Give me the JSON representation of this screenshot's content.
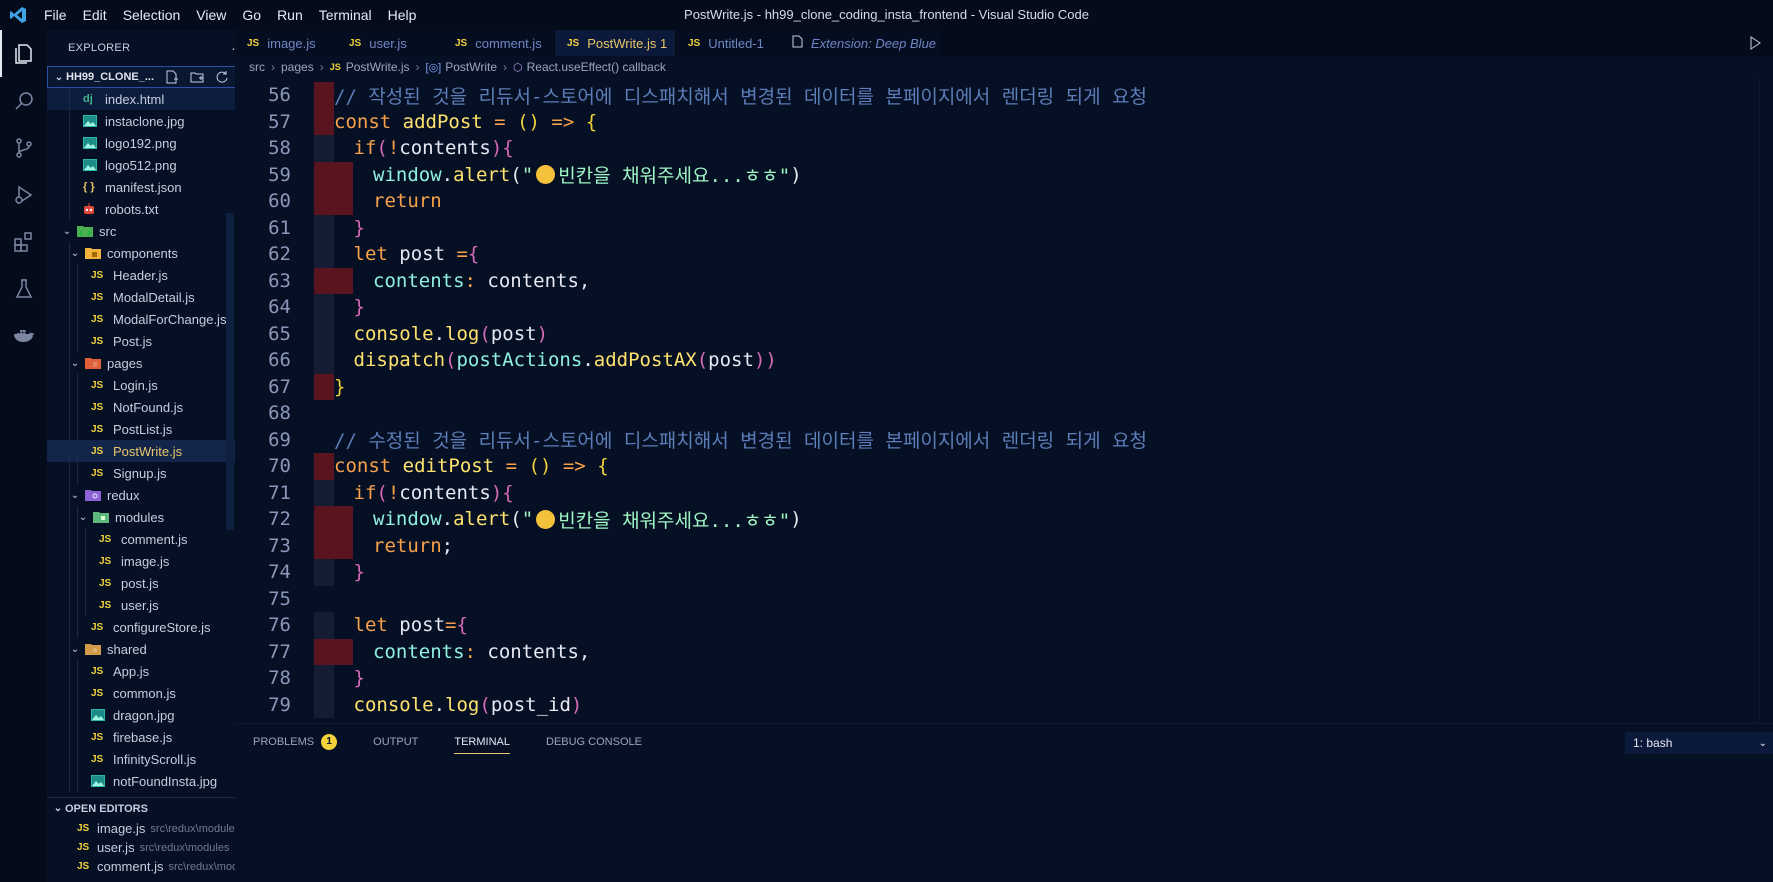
{
  "window": {
    "title": "PostWrite.js - hh99_clone_coding_insta_frontend - Visual Studio Code"
  },
  "menu": [
    "File",
    "Edit",
    "Selection",
    "View",
    "Go",
    "Run",
    "Terminal",
    "Help"
  ],
  "activity_bar": [
    "explorer-icon",
    "search-icon",
    "source-control-icon",
    "run-debug-icon",
    "extensions-icon",
    "testing-icon",
    "docker-icon"
  ],
  "explorer": {
    "title": "EXPLORER",
    "more": "···",
    "folder": "HH99_CLONE_...",
    "tree": [
      {
        "label": "index.html",
        "icon": "dj",
        "depth": 2,
        "state": "focused"
      },
      {
        "label": "instaclone.jpg",
        "icon": "image",
        "depth": 2
      },
      {
        "label": "logo192.png",
        "icon": "image",
        "depth": 2
      },
      {
        "label": "logo512.png",
        "icon": "image",
        "depth": 2
      },
      {
        "label": "manifest.json",
        "icon": "json",
        "depth": 2
      },
      {
        "label": "robots.txt",
        "icon": "robot",
        "depth": 2
      },
      {
        "label": "src",
        "icon": "folder-src",
        "depth": 1,
        "folder": true,
        "dot": true
      },
      {
        "label": "components",
        "icon": "folder-components",
        "depth": 2,
        "folder": true
      },
      {
        "label": "Header.js",
        "icon": "js",
        "depth": 3
      },
      {
        "label": "ModalDetail.js",
        "icon": "js",
        "depth": 3
      },
      {
        "label": "ModalForChange.js",
        "icon": "js",
        "depth": 3
      },
      {
        "label": "Post.js",
        "icon": "js",
        "depth": 3
      },
      {
        "label": "pages",
        "icon": "folder-pages",
        "depth": 2,
        "folder": true,
        "dot": true
      },
      {
        "label": "Login.js",
        "icon": "js",
        "depth": 3
      },
      {
        "label": "NotFound.js",
        "icon": "js",
        "depth": 3
      },
      {
        "label": "PostList.js",
        "icon": "js",
        "depth": 3
      },
      {
        "label": "PostWrite.js",
        "icon": "js",
        "depth": 3,
        "state": "selected",
        "badge": "1",
        "modified": true
      },
      {
        "label": "Signup.js",
        "icon": "js",
        "depth": 3
      },
      {
        "label": "redux",
        "icon": "folder-redux",
        "depth": 2,
        "folder": true
      },
      {
        "label": "modules",
        "icon": "folder-modules",
        "depth": 3,
        "folder": true
      },
      {
        "label": "comment.js",
        "icon": "js",
        "depth": 4
      },
      {
        "label": "image.js",
        "icon": "js",
        "depth": 4
      },
      {
        "label": "post.js",
        "icon": "js",
        "depth": 4
      },
      {
        "label": "user.js",
        "icon": "js",
        "depth": 4
      },
      {
        "label": "configureStore.js",
        "icon": "js",
        "depth": 3
      },
      {
        "label": "shared",
        "icon": "folder-shared",
        "depth": 2,
        "folder": true
      },
      {
        "label": "App.js",
        "icon": "js",
        "depth": 3
      },
      {
        "label": "common.js",
        "icon": "js",
        "depth": 3
      },
      {
        "label": "dragon.jpg",
        "icon": "image",
        "depth": 3
      },
      {
        "label": "firebase.js",
        "icon": "js",
        "depth": 3
      },
      {
        "label": "InfinityScroll.js",
        "icon": "js",
        "depth": 3
      },
      {
        "label": "notFoundInsta.jpg",
        "icon": "image",
        "depth": 3
      }
    ],
    "open_editors_title": "OPEN EDITORS",
    "open_editors": [
      {
        "name": "image.js",
        "path": "src\\redux\\modules"
      },
      {
        "name": "user.js",
        "path": "src\\redux\\modules"
      },
      {
        "name": "comment.js",
        "path": "src\\redux\\mod..."
      }
    ]
  },
  "tabs": [
    {
      "label": "image.js",
      "icon": "JS"
    },
    {
      "label": "user.js",
      "icon": "JS"
    },
    {
      "label": "comment.js",
      "icon": "JS"
    },
    {
      "label": "PostWrite.js 1",
      "icon": "JS",
      "active": true,
      "close": "×"
    },
    {
      "label": "Untitled-1",
      "icon": "JS"
    },
    {
      "label": "Extension: Deep Blue",
      "icon": "file",
      "preview": true
    }
  ],
  "breadcrumb": [
    "src",
    "pages",
    "PostWrite.js",
    "PostWrite",
    "React.useEffect() callback"
  ],
  "code": {
    "lines": [
      {
        "n": "56",
        "indent": 0,
        "err": [
          0
        ],
        "tokens": [
          [
            "cm",
            "// 작성된 것을 리듀서-스토어에 디스패치해서 변경된 데이터를 본페이지에서 렌더링 되게 요청"
          ]
        ]
      },
      {
        "n": "57",
        "indent": 0,
        "err": [
          0
        ],
        "tokens": [
          [
            "kw",
            "const "
          ],
          [
            "fn",
            "addPost"
          ],
          [
            "var",
            " "
          ],
          [
            "kw",
            "="
          ],
          [
            "var",
            " "
          ],
          [
            "p1",
            "()"
          ],
          [
            "var",
            " "
          ],
          [
            "kw",
            "=>"
          ],
          [
            "var",
            " "
          ],
          [
            "p1",
            "{"
          ]
        ]
      },
      {
        "n": "58",
        "indent": 1,
        "err": [],
        "tokens": [
          [
            "kw",
            "if"
          ],
          [
            "p2",
            "("
          ],
          [
            "kw",
            "!"
          ],
          [
            "var",
            "contents"
          ],
          [
            "p2",
            ")"
          ],
          [
            "p2",
            "{"
          ]
        ]
      },
      {
        "n": "59",
        "indent": 2,
        "err": [
          0,
          1
        ],
        "tokens": [
          [
            "obj",
            "window"
          ],
          [
            "var",
            "."
          ],
          [
            "fn",
            "alert"
          ],
          [
            "var",
            "("
          ],
          [
            "str",
            "\""
          ],
          [
            "emoji",
            ""
          ],
          [
            "str",
            "빈칸을 채워주세요...ㅎㅎ\""
          ],
          [
            "var",
            ")"
          ]
        ]
      },
      {
        "n": "60",
        "indent": 2,
        "err": [
          0,
          1
        ],
        "tokens": [
          [
            "kw",
            "return"
          ]
        ]
      },
      {
        "n": "61",
        "indent": 1,
        "err": [],
        "tokens": [
          [
            "p2",
            "}"
          ]
        ]
      },
      {
        "n": "62",
        "indent": 1,
        "err": [],
        "tokens": [
          [
            "kw",
            "let "
          ],
          [
            "var",
            "post "
          ],
          [
            "kw",
            "="
          ],
          [
            "p2",
            "{"
          ]
        ]
      },
      {
        "n": "63",
        "indent": 2,
        "err": [
          0,
          1
        ],
        "tokens": [
          [
            "prop",
            "contents"
          ],
          [
            "kw",
            ":"
          ],
          [
            "var",
            " contents,"
          ]
        ]
      },
      {
        "n": "64",
        "indent": 1,
        "err": [],
        "tokens": [
          [
            "p2",
            "}"
          ]
        ]
      },
      {
        "n": "65",
        "indent": 1,
        "err": [],
        "tokens": [
          [
            "fn",
            "console"
          ],
          [
            "var",
            "."
          ],
          [
            "fn",
            "log"
          ],
          [
            "p2",
            "("
          ],
          [
            "var",
            "post"
          ],
          [
            "p2",
            ")"
          ]
        ]
      },
      {
        "n": "66",
        "indent": 1,
        "err": [],
        "tokens": [
          [
            "fn",
            "dispatch"
          ],
          [
            "p2",
            "("
          ],
          [
            "obj",
            "postActions"
          ],
          [
            "var",
            "."
          ],
          [
            "fn",
            "addPostAX"
          ],
          [
            "p2",
            "("
          ],
          [
            "var",
            "post"
          ],
          [
            "p2",
            "))"
          ]
        ]
      },
      {
        "n": "67",
        "indent": 0,
        "err": [
          0
        ],
        "tokens": [
          [
            "p1",
            "}"
          ]
        ]
      },
      {
        "n": "68",
        "indent": 0,
        "err": [],
        "tokens": []
      },
      {
        "n": "69",
        "indent": 0,
        "err": [],
        "tokens": [
          [
            "cm",
            "// 수정된 것을 리듀서-스토어에 디스패치해서 변경된 데이터를 본페이지에서 렌더링 되게 요청"
          ]
        ]
      },
      {
        "n": "70",
        "indent": 0,
        "err": [
          0
        ],
        "tokens": [
          [
            "kw",
            "const "
          ],
          [
            "fn",
            "editPost"
          ],
          [
            "var",
            " "
          ],
          [
            "kw",
            "="
          ],
          [
            "var",
            " "
          ],
          [
            "p1",
            "()"
          ],
          [
            "var",
            " "
          ],
          [
            "kw",
            "=>"
          ],
          [
            "var",
            " "
          ],
          [
            "p1",
            "{"
          ]
        ]
      },
      {
        "n": "71",
        "indent": 1,
        "err": [],
        "tokens": [
          [
            "kw",
            "if"
          ],
          [
            "p2",
            "("
          ],
          [
            "kw",
            "!"
          ],
          [
            "var",
            "contents"
          ],
          [
            "p2",
            ")"
          ],
          [
            "p2",
            "{"
          ]
        ]
      },
      {
        "n": "72",
        "indent": 2,
        "err": [
          0,
          1
        ],
        "tokens": [
          [
            "obj",
            "window"
          ],
          [
            "var",
            "."
          ],
          [
            "fn",
            "alert"
          ],
          [
            "var",
            "("
          ],
          [
            "str",
            "\""
          ],
          [
            "emoji",
            ""
          ],
          [
            "str",
            "빈칸을 채워주세요...ㅎㅎ\""
          ],
          [
            "var",
            ")"
          ]
        ]
      },
      {
        "n": "73",
        "indent": 2,
        "err": [
          0,
          1
        ],
        "tokens": [
          [
            "kw",
            "return"
          ],
          [
            "var",
            ";"
          ]
        ]
      },
      {
        "n": "74",
        "indent": 1,
        "err": [],
        "tokens": [
          [
            "p2",
            "}"
          ]
        ]
      },
      {
        "n": "75",
        "indent": 0,
        "err": [],
        "tokens": []
      },
      {
        "n": "76",
        "indent": 1,
        "err": [],
        "tokens": [
          [
            "kw",
            "let "
          ],
          [
            "var",
            "post"
          ],
          [
            "kw",
            "="
          ],
          [
            "p2",
            "{"
          ]
        ]
      },
      {
        "n": "77",
        "indent": 2,
        "err": [
          0,
          1
        ],
        "tokens": [
          [
            "prop",
            "contents"
          ],
          [
            "kw",
            ":"
          ],
          [
            "var",
            " contents,"
          ]
        ]
      },
      {
        "n": "78",
        "indent": 1,
        "err": [],
        "tokens": [
          [
            "p2",
            "}"
          ]
        ]
      },
      {
        "n": "79",
        "indent": 1,
        "err": [],
        "tokens": [
          [
            "fn",
            "console"
          ],
          [
            "var",
            "."
          ],
          [
            "fn",
            "log"
          ],
          [
            "p2",
            "("
          ],
          [
            "var",
            "post_id"
          ],
          [
            "p2",
            ")"
          ]
        ]
      }
    ]
  },
  "panel": {
    "tabs": [
      "PROBLEMS",
      "OUTPUT",
      "TERMINAL",
      "DEBUG CONSOLE"
    ],
    "problems_count": "1",
    "active": "TERMINAL",
    "terminal_select": "1: bash",
    "plus": "+"
  },
  "colors": {
    "background": "#061024",
    "accent": "#e8c66a",
    "error_indent": "#5a1420"
  }
}
